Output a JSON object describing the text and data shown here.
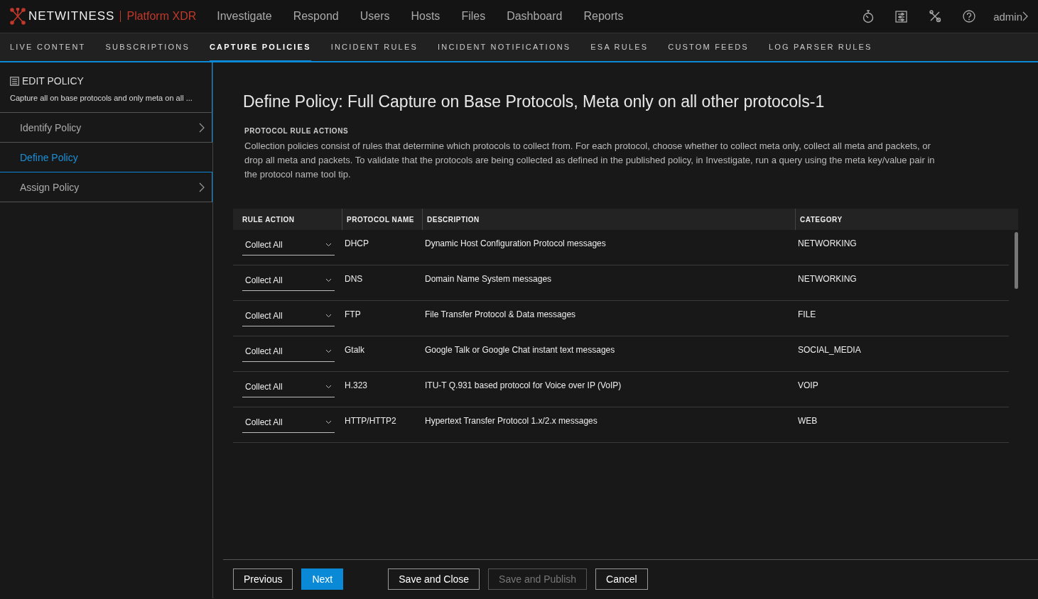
{
  "header": {
    "brand": "NETWITNESS",
    "product": "Platform XDR",
    "nav": [
      "Investigate",
      "Respond",
      "Users",
      "Hosts",
      "Files",
      "Dashboard",
      "Reports"
    ],
    "user": "admin"
  },
  "subnav": [
    {
      "label": "LIVE CONTENT",
      "selected": false
    },
    {
      "label": "SUBSCRIPTIONS",
      "selected": false
    },
    {
      "label": "CAPTURE POLICIES",
      "selected": true
    },
    {
      "label": "INCIDENT RULES",
      "selected": false
    },
    {
      "label": "INCIDENT NOTIFICATIONS",
      "selected": false
    },
    {
      "label": "ESA RULES",
      "selected": false
    },
    {
      "label": "CUSTOM FEEDS",
      "selected": false
    },
    {
      "label": "LOG PARSER RULES",
      "selected": false
    }
  ],
  "sidebar": {
    "title": "EDIT POLICY",
    "subtitle": "Capture all on base protocols and only meta on all ...",
    "steps": [
      {
        "label": "Identify Policy",
        "selected": false
      },
      {
        "label": "Define Policy",
        "selected": true
      },
      {
        "label": "Assign Policy",
        "selected": false
      }
    ]
  },
  "main": {
    "title": "Define Policy: Full Capture on Base Protocols, Meta only on all other protocols-1",
    "section": "PROTOCOL RULE ACTIONS",
    "description": "Collection policies consist of rules that determine which protocols to collect from. For each protocol, choose whether to collect meta only, collect all meta and packets, or drop all meta and packets. To validate that the protocols are being collected as defined in the published policy, in Investigate, run a query using the meta key/value pair in the protocol name tool tip."
  },
  "table": {
    "columns": [
      "RULE ACTION",
      "PROTOCOL NAME",
      "DESCRIPTION",
      "CATEGORY"
    ],
    "rows": [
      {
        "action": "Collect All",
        "protocol": "DHCP",
        "description": "Dynamic Host Configuration Protocol messages",
        "category": "NETWORKING"
      },
      {
        "action": "Collect All",
        "protocol": "DNS",
        "description": "Domain Name System messages",
        "category": "NETWORKING"
      },
      {
        "action": "Collect All",
        "protocol": "FTP",
        "description": "File Transfer Protocol & Data messages",
        "category": "FILE"
      },
      {
        "action": "Collect All",
        "protocol": "Gtalk",
        "description": "Google Talk or Google Chat instant text messages",
        "category": "SOCIAL_MEDIA"
      },
      {
        "action": "Collect All",
        "protocol": "H.323",
        "description": "ITU-T Q.931 based protocol for Voice over IP (VoIP)",
        "category": "VOIP"
      },
      {
        "action": "Collect All",
        "protocol": "HTTP/HTTP2",
        "description": "Hypertext Transfer Protocol 1.x/2.x messages",
        "category": "WEB"
      }
    ]
  },
  "footer": [
    {
      "label": "Previous",
      "kind": "normal"
    },
    {
      "label": "Next",
      "kind": "primary"
    },
    {
      "label": "Save and Close",
      "kind": "normal"
    },
    {
      "label": "Save and Publish",
      "kind": "disabled"
    },
    {
      "label": "Cancel",
      "kind": "normal"
    }
  ]
}
